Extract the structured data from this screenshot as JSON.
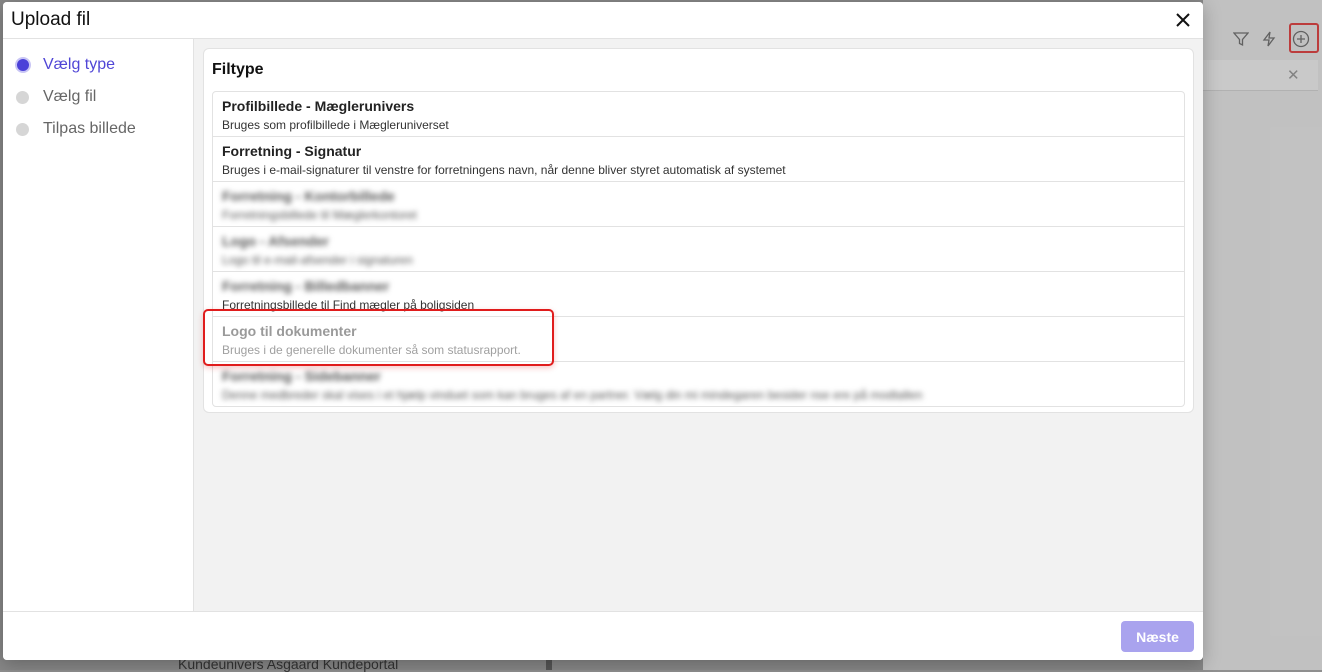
{
  "modal": {
    "title": "Upload fil",
    "close_icon": "close-icon"
  },
  "steps": [
    {
      "label": "Vælg type",
      "active": true
    },
    {
      "label": "Vælg fil",
      "active": false
    },
    {
      "label": "Tilpas billede",
      "active": false
    }
  ],
  "filetype": {
    "heading": "Filtype",
    "items": [
      {
        "title": "Profilbillede - Mæglerunivers",
        "desc": "Bruges som profilbillede i Mægleruniverset"
      },
      {
        "title": "Forretning - Signatur",
        "desc": "Bruges i e-mail-signaturer til venstre for forretningens navn, når denne bliver styret automatisk af systemet"
      },
      {
        "title": "Forretning - Kontorbillede",
        "desc": "Forretningsbillede til Mæglerkontoret"
      },
      {
        "title": "Logo - Afsender",
        "desc": "Logo til e-mail-afsender i signaturen"
      },
      {
        "title": "Forretning - Billedbanner",
        "desc": "Forretningsbillede til Find mægler på boligsiden"
      },
      {
        "title": "Logo til dokumenter",
        "desc": "Bruges i de generelle dokumenter så som statusrapport."
      },
      {
        "title": "Forretning - Sidebanner",
        "desc": "Denne medbreder skal vises i et hjælp vinduet som kan bruges af en partner. Vælg din mi mindegaren besider nse ere på modtallen"
      }
    ]
  },
  "footer": {
    "next_label": "Næste"
  },
  "background": {
    "bottom_text": "Kundeunivers Asgaard Kundeportal",
    "icons": [
      "filter-icon",
      "lightning-icon",
      "add-circle-icon"
    ]
  },
  "colors": {
    "accent": "#4b41d8",
    "next_button": "#a9a3ee",
    "highlight": "#e01c1c"
  }
}
